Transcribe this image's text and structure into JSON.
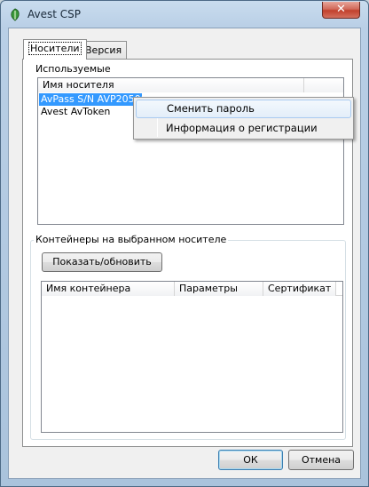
{
  "window": {
    "title": "Avest CSP"
  },
  "tabs": [
    {
      "label": "Носители",
      "active": true
    },
    {
      "label": "Версия",
      "active": false
    }
  ],
  "media_group": {
    "label": "Используемые",
    "columns": [
      "Имя носителя",
      ""
    ],
    "rows": [
      {
        "name": "AvPass S/N AVP20500",
        "selected": true
      },
      {
        "name": "Avest AvToken",
        "selected": false
      }
    ]
  },
  "containers_group": {
    "label": "Контейнеры на выбранном носителе",
    "refresh_label": "Показать/обновить",
    "columns": [
      "Имя контейнера",
      "Параметры",
      "Сертификат"
    ]
  },
  "context_menu": {
    "items": [
      {
        "label": "Сменить пароль",
        "hovered": true
      },
      {
        "label": "Информация о регистрации",
        "hovered": false
      }
    ]
  },
  "buttons": {
    "ok": "ОК",
    "cancel": "Отмена"
  },
  "icons": {
    "app": "avest-leaf-icon",
    "close": "close-icon"
  },
  "colors": {
    "selection": "#3399ff",
    "close_button": "#c2402c"
  }
}
